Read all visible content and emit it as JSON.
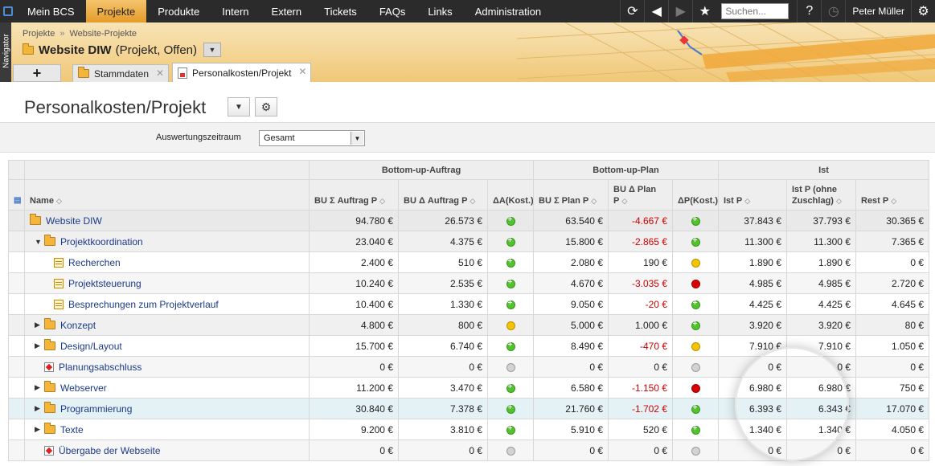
{
  "topnav": {
    "items": [
      "Mein BCS",
      "Projekte",
      "Produkte",
      "Intern",
      "Extern",
      "Tickets",
      "FAQs",
      "Links",
      "Administration"
    ],
    "active": "Projekte",
    "search_placeholder": "Suchen...",
    "help": "?",
    "user": "Peter Müller"
  },
  "navigator_label": "Navigator",
  "header": {
    "breadcrumb": [
      "Projekte",
      "Website-Projekte"
    ],
    "project_name": "Website DIW",
    "project_meta": "(Projekt, Offen)",
    "tabs": [
      "Stammdaten",
      "Personalkosten/Projekt"
    ],
    "add_tab": "+"
  },
  "page": {
    "title": "Personalkosten/Projekt"
  },
  "filter": {
    "label": "Auswertungszeitraum",
    "value": "Gesamt"
  },
  "table": {
    "groups": [
      "Bottom-up-Auftrag",
      "Bottom-up-Plan",
      "Ist"
    ],
    "columns": [
      "Name",
      "BU Σ Auftrag P",
      "BU Δ Auftrag P",
      "ΔA(Kost.)",
      "BU Σ Plan P",
      "BU Δ Plan P",
      "ΔP(Kost.)",
      "Ist P",
      "Ist P (ohne Zuschlag)",
      "Rest P"
    ],
    "rows": [
      {
        "name": "Website DIW",
        "c1": "94.780 €",
        "c2": "26.573 €",
        "a": "green",
        "c3": "63.540 €",
        "c4": "-4.667 €",
        "p": "green",
        "c5": "37.843 €",
        "c6": "37.793 €",
        "c7": "30.365 €"
      },
      {
        "name": "Projektkoordination",
        "c1": "23.040 €",
        "c2": "4.375 €",
        "a": "green",
        "c3": "15.800 €",
        "c4": "-2.865 €",
        "p": "green",
        "c5": "11.300 €",
        "c6": "11.300 €",
        "c7": "7.365 €"
      },
      {
        "name": "Recherchen",
        "c1": "2.400 €",
        "c2": "510 €",
        "a": "green",
        "c3": "2.080 €",
        "c4": "190 €",
        "p": "yellow",
        "c5": "1.890 €",
        "c6": "1.890 €",
        "c7": "0 €"
      },
      {
        "name": "Projektsteuerung",
        "c1": "10.240 €",
        "c2": "2.535 €",
        "a": "green",
        "c3": "4.670 €",
        "c4": "-3.035 €",
        "p": "red",
        "c5": "4.985 €",
        "c6": "4.985 €",
        "c7": "2.720 €"
      },
      {
        "name": "Besprechungen zum Projektverlauf",
        "c1": "10.400 €",
        "c2": "1.330 €",
        "a": "green",
        "c3": "9.050 €",
        "c4": "-20 €",
        "p": "green",
        "c5": "4.425 €",
        "c6": "4.425 €",
        "c7": "4.645 €"
      },
      {
        "name": "Konzept",
        "c1": "4.800 €",
        "c2": "800 €",
        "a": "yellow",
        "c3": "5.000 €",
        "c4": "1.000 €",
        "p": "green",
        "c5": "3.920 €",
        "c6": "3.920 €",
        "c7": "80 €"
      },
      {
        "name": "Design/Layout",
        "c1": "15.700 €",
        "c2": "6.740 €",
        "a": "green",
        "c3": "8.490 €",
        "c4": "-470 €",
        "p": "yellow",
        "c5": "7.910 €",
        "c6": "7.910 €",
        "c7": "1.050 €"
      },
      {
        "name": "Planungsabschluss",
        "c1": "0 €",
        "c2": "0 €",
        "a": "gray",
        "c3": "0 €",
        "c4": "0 €",
        "p": "gray",
        "c5": "0 €",
        "c6": "0 €",
        "c7": "0 €"
      },
      {
        "name": "Webserver",
        "c1": "11.200 €",
        "c2": "3.470 €",
        "a": "green",
        "c3": "6.580 €",
        "c4": "-1.150 €",
        "p": "red",
        "c5": "6.980 €",
        "c6": "6.980 €",
        "c7": "750 €"
      },
      {
        "name": "Programmierung",
        "c1": "30.840 €",
        "c2": "7.378 €",
        "a": "green",
        "c3": "21.760 €",
        "c4": "-1.702 €",
        "p": "green",
        "c5": "6.393 €",
        "c6": "6.343 €",
        "c7": "17.070 €"
      },
      {
        "name": "Texte",
        "c1": "9.200 €",
        "c2": "3.810 €",
        "a": "green",
        "c3": "5.910 €",
        "c4": "520 €",
        "p": "green",
        "c5": "1.340 €",
        "c6": "1.340 €",
        "c7": "4.050 €"
      },
      {
        "name": "Übergabe der Webseite",
        "c1": "0 €",
        "c2": "0 €",
        "a": "gray",
        "c3": "0 €",
        "c4": "0 €",
        "p": "gray",
        "c5": "0 €",
        "c6": "0 €",
        "c7": "0 €"
      }
    ]
  },
  "colors": {
    "accent": "#e59b28",
    "negative": "#d00000",
    "link": "#1a3a8a"
  }
}
